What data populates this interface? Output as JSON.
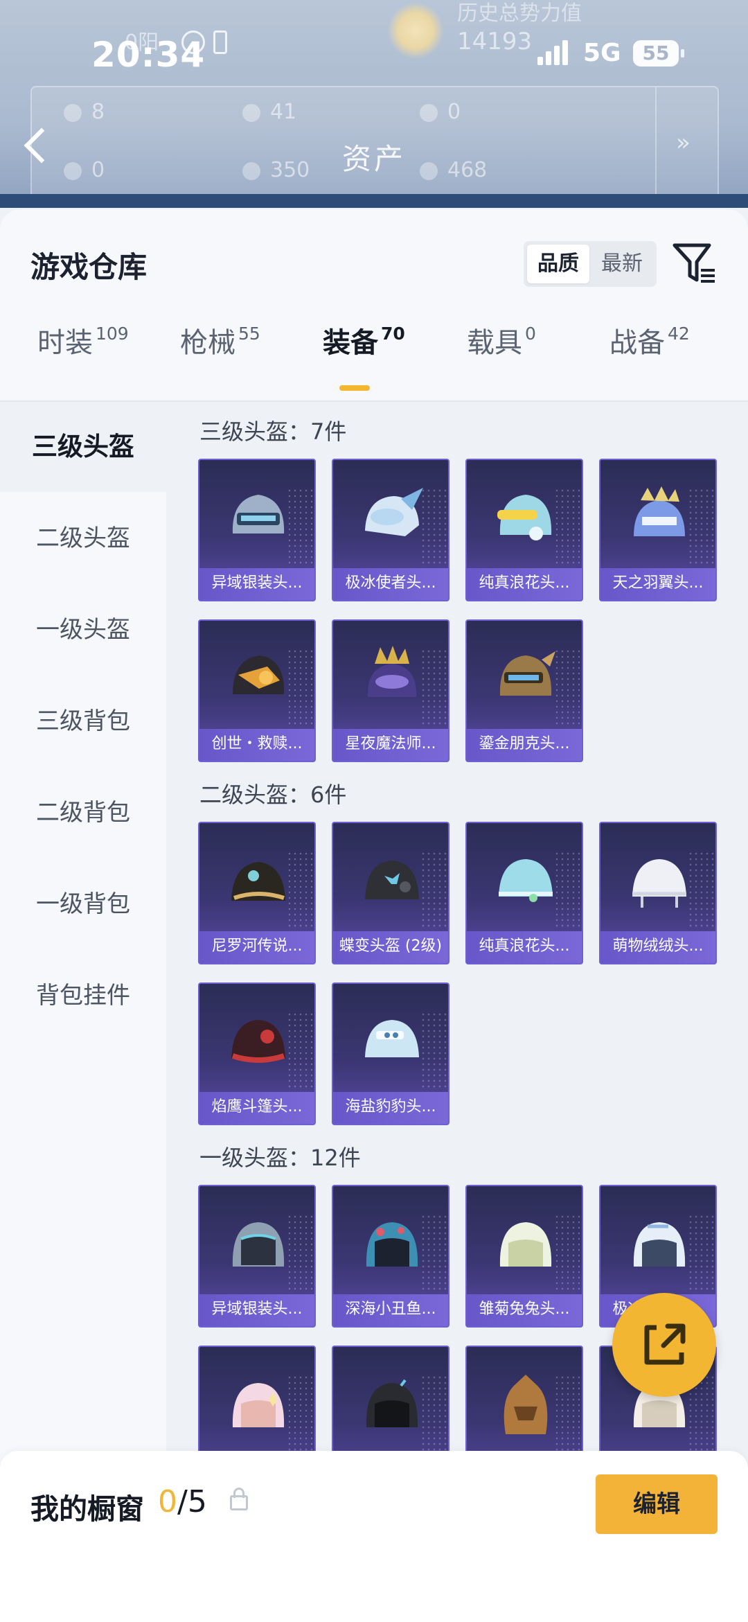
{
  "status_bar": {
    "time": "20:34",
    "ghost_text": "0阳",
    "ghost_number": "14193",
    "ghost_top": "历史总势力值",
    "network": "5G",
    "battery": "55"
  },
  "asset_header": {
    "title": "资产",
    "values": [
      "8",
      "41",
      "0",
      "0",
      "350",
      "468"
    ]
  },
  "warehouse": {
    "title": "游戏仓库",
    "sort_options": [
      "品质",
      "最新"
    ],
    "sort_selected": "品质"
  },
  "tabs": [
    {
      "label": "时装",
      "count": "109"
    },
    {
      "label": "枪械",
      "count": "55"
    },
    {
      "label": "装备",
      "count": "70"
    },
    {
      "label": "载具",
      "count": "0"
    },
    {
      "label": "战备",
      "count": "42"
    }
  ],
  "sidebar": {
    "items": [
      "三级头盔",
      "二级头盔",
      "一级头盔",
      "三级背包",
      "二级背包",
      "一级背包",
      "背包挂件"
    ]
  },
  "sections": [
    {
      "title": "三级头盔：7件",
      "items": [
        "异域银装头...",
        "极冰使者头...",
        "纯真浪花头...",
        "天之羽翼头...",
        "创世・救赎...",
        "星夜魔法师...",
        "鎏金朋克头..."
      ]
    },
    {
      "title": "二级头盔：6件",
      "items": [
        "尼罗河传说...",
        "蝶变头盔 (2级)",
        "纯真浪花头...",
        "萌物绒绒头...",
        "焰鹰斗篷头...",
        "海盐豹豹头..."
      ]
    },
    {
      "title": "一级头盔：12件",
      "items": [
        "异域银装头...",
        "深海小丑鱼...",
        "雏菊兔兔头...",
        "极冰使者头..."
      ]
    }
  ],
  "showcase": {
    "title": "我的橱窗",
    "current": "0",
    "total": "/5",
    "edit_label": "编辑"
  },
  "colors": {
    "accent": "#f2b632",
    "card_bg": "#3b3672",
    "card_label": "#6e5ed0"
  }
}
